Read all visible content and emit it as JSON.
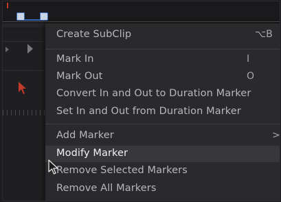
{
  "menu": {
    "items": [
      {
        "label": "Create SubClip",
        "shortcut": "⌥B"
      },
      {
        "label": "Mark In",
        "shortcut": "I"
      },
      {
        "label": "Mark Out",
        "shortcut": "O"
      },
      {
        "label": "Convert In and Out to Duration Marker",
        "shortcut": ""
      },
      {
        "label": "Set In and Out from Duration Marker",
        "shortcut": ""
      },
      {
        "label": "Add Marker",
        "submenu_arrow": ">"
      },
      {
        "label": "Modify Marker",
        "shortcut": ""
      },
      {
        "label": "Remove Selected Markers",
        "shortcut": ""
      },
      {
        "label": "Remove All Markers",
        "shortcut": ""
      }
    ]
  },
  "icons": {
    "cursor": "mouse-pointer-icon",
    "red_pointer": "selection-arrow-icon",
    "play": "play-icon",
    "submenu": "chevron-right-icon"
  },
  "colors": {
    "menu_bg": "#2a2a2d",
    "highlight_bg": "#38383b",
    "text": "#b8b8bc",
    "accent_red": "#c23a2c",
    "range_blue": "#3a66b8"
  }
}
